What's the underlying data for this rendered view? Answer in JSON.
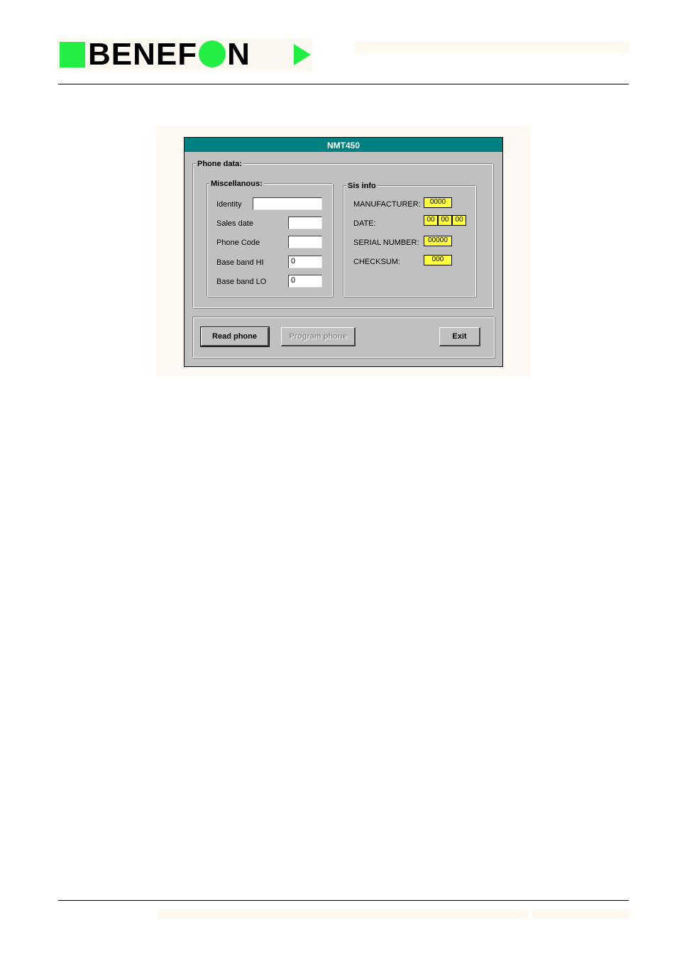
{
  "header": {
    "logo_text_left": "BENEF",
    "logo_text_right": "N",
    "brand_color": "#22ee44"
  },
  "dialog": {
    "title": "NMT450",
    "phone_data_label": "Phone data:",
    "misc": {
      "label": "Miscellanous:",
      "fields": [
        {
          "label": "Identity",
          "value": ""
        },
        {
          "label": "Sales date",
          "value": ""
        },
        {
          "label": "Phone Code",
          "value": ""
        },
        {
          "label": "Base band HI",
          "value": "0"
        },
        {
          "label": "Base band LO",
          "value": "0"
        }
      ]
    },
    "sis": {
      "label": "Sis info",
      "manufacturer_label": "MANUFACTURER:",
      "manufacturer_value": "0000",
      "date_label": "DATE:",
      "date_values": [
        "00",
        "00",
        "00"
      ],
      "serial_label": "SERIAL NUMBER:",
      "serial_value": "00000",
      "checksum_label": "CHECKSUM:",
      "checksum_value": "000"
    },
    "buttons": {
      "read_phone": "Read phone",
      "program_phone": "Program phone",
      "exit": "Exit"
    },
    "title_bar_color": "#008080",
    "field_highlight_color": "#ffff40"
  }
}
